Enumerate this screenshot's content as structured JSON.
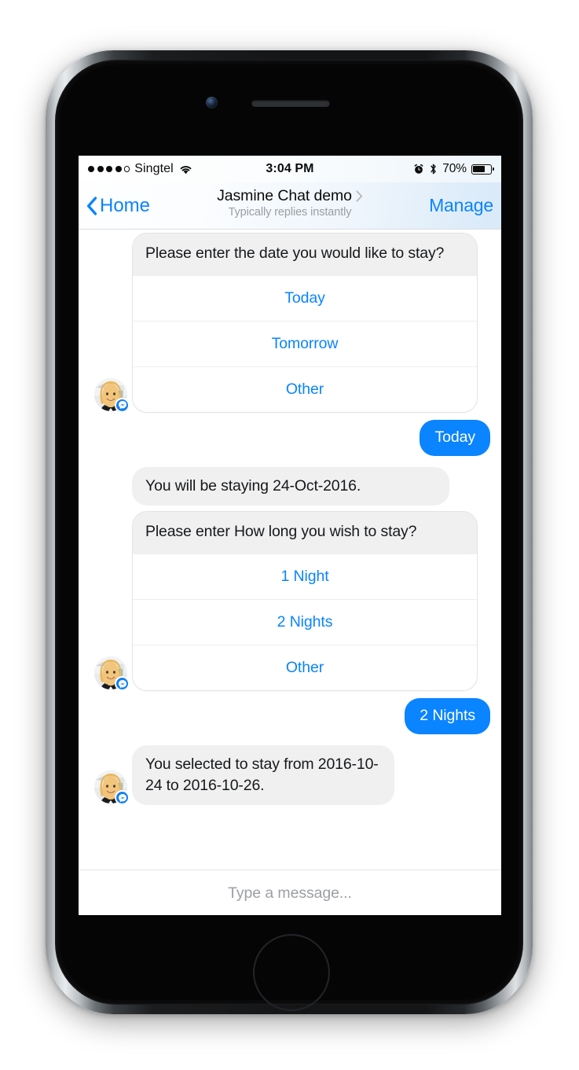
{
  "device": {
    "name": "iphone-6s-space-grey",
    "home_button": "home-button"
  },
  "status_bar": {
    "carrier": "Singtel",
    "signal_dots_filled": 4,
    "signal_dots_total": 5,
    "wifi_icon": "wifi-icon",
    "time": "3:04 PM",
    "alarm_icon": "alarm-clock-icon",
    "bluetooth_icon": "bluetooth-icon",
    "battery_percent": "70%",
    "battery_level": 70
  },
  "nav_bar": {
    "back_label": "Home",
    "back_icon": "chevron-left-icon",
    "title": "Jasmine Chat demo",
    "title_chevron_icon": "chevron-right-icon",
    "subtitle": "Typically replies instantly",
    "action_label": "Manage",
    "accent_color": "#0a84ff"
  },
  "conversation": {
    "accent_blue": "#0a84ff",
    "bubble_grey": "#f0f0f1",
    "messages": [
      {
        "id": "msg-date-card",
        "type": "card",
        "from": "bot",
        "avatar": "agent-avatar",
        "question": "Please enter the date you would like to stay?",
        "options": [
          "Today",
          "Tomorrow",
          "Other"
        ]
      },
      {
        "id": "msg-reply-today",
        "type": "text",
        "from": "user",
        "text": "Today"
      },
      {
        "id": "msg-confirm-date",
        "type": "text",
        "from": "bot",
        "text": "You will be staying 24-Oct-2016."
      },
      {
        "id": "msg-nights-card",
        "type": "card",
        "from": "bot",
        "avatar": "agent-avatar",
        "question": "Please enter How long you wish to stay?",
        "options": [
          "1 Night",
          "2 Nights",
          "Other"
        ]
      },
      {
        "id": "msg-reply-nights",
        "type": "text",
        "from": "user",
        "text": "2 Nights"
      },
      {
        "id": "msg-confirm-stay",
        "type": "text",
        "from": "bot",
        "avatar": "agent-avatar",
        "text": "You selected to stay from 2016-10-24 to 2016-10-26."
      }
    ]
  },
  "composer": {
    "placeholder": "Type a message...",
    "value": ""
  }
}
